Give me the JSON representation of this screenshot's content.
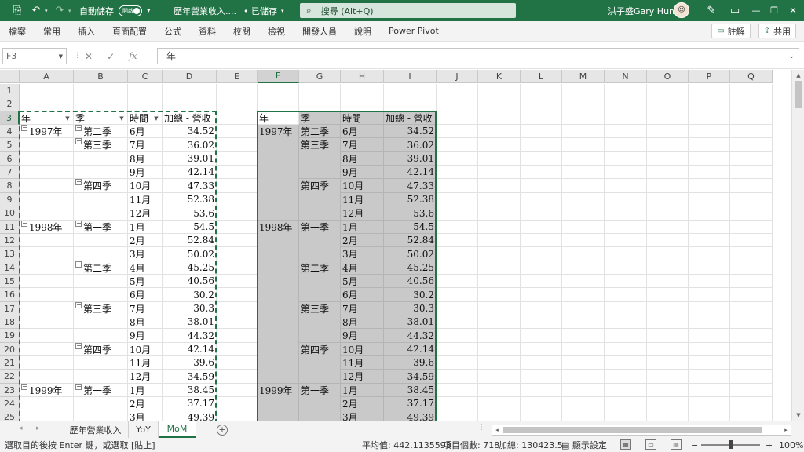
{
  "titlebar": {
    "autosave_label": "自動儲存",
    "autosave_state": "開啟",
    "doc_title": "歷年營業收入....",
    "saved_state": "• 已儲存",
    "search_placeholder": "搜尋 (Alt+Q)",
    "user_name": "洪子盛Gary Hung"
  },
  "ribbon": {
    "tabs": [
      "檔案",
      "常用",
      "插入",
      "頁面配置",
      "公式",
      "資料",
      "校閱",
      "檢視",
      "開發人員",
      "說明",
      "Power Pivot"
    ],
    "comment_label": "註解",
    "share_label": "共用"
  },
  "formula_bar": {
    "name_box": "F3",
    "fx": "fx",
    "value": "年"
  },
  "columns": [
    "A",
    "B",
    "C",
    "D",
    "E",
    "F",
    "G",
    "H",
    "I",
    "J",
    "K",
    "L",
    "M",
    "N",
    "O",
    "P",
    "Q"
  ],
  "rows": [
    "1",
    "2",
    "3",
    "4",
    "5",
    "6",
    "7",
    "8",
    "9",
    "10",
    "11",
    "12",
    "13",
    "14",
    "15",
    "16",
    "17",
    "18",
    "19",
    "20",
    "21",
    "22",
    "23",
    "24",
    "25"
  ],
  "pivot": {
    "headers": [
      "年",
      "季",
      "時間",
      "加總 - 營收"
    ],
    "rows": [
      {
        "year": "1997年",
        "quarter": "第二季",
        "month": "6月",
        "value": "34.52"
      },
      {
        "year": "",
        "quarter": "第三季",
        "month": "7月",
        "value": "36.02"
      },
      {
        "year": "",
        "quarter": "",
        "month": "8月",
        "value": "39.01"
      },
      {
        "year": "",
        "quarter": "",
        "month": "9月",
        "value": "42.14"
      },
      {
        "year": "",
        "quarter": "第四季",
        "month": "10月",
        "value": "47.33"
      },
      {
        "year": "",
        "quarter": "",
        "month": "11月",
        "value": "52.38"
      },
      {
        "year": "",
        "quarter": "",
        "month": "12月",
        "value": "53.6"
      },
      {
        "year": "1998年",
        "quarter": "第一季",
        "month": "1月",
        "value": "54.5"
      },
      {
        "year": "",
        "quarter": "",
        "month": "2月",
        "value": "52.84"
      },
      {
        "year": "",
        "quarter": "",
        "month": "3月",
        "value": "50.02"
      },
      {
        "year": "",
        "quarter": "第二季",
        "month": "4月",
        "value": "45.25"
      },
      {
        "year": "",
        "quarter": "",
        "month": "5月",
        "value": "40.56"
      },
      {
        "year": "",
        "quarter": "",
        "month": "6月",
        "value": "30.2"
      },
      {
        "year": "",
        "quarter": "第三季",
        "month": "7月",
        "value": "30.3"
      },
      {
        "year": "",
        "quarter": "",
        "month": "8月",
        "value": "38.01"
      },
      {
        "year": "",
        "quarter": "",
        "month": "9月",
        "value": "44.32"
      },
      {
        "year": "",
        "quarter": "第四季",
        "month": "10月",
        "value": "42.14"
      },
      {
        "year": "",
        "quarter": "",
        "month": "11月",
        "value": "39.6"
      },
      {
        "year": "",
        "quarter": "",
        "month": "12月",
        "value": "34.59"
      },
      {
        "year": "1999年",
        "quarter": "第一季",
        "month": "1月",
        "value": "38.45"
      },
      {
        "year": "",
        "quarter": "",
        "month": "2月",
        "value": "37.17"
      },
      {
        "year": "",
        "quarter": "",
        "month": "3月",
        "value": "49.39"
      }
    ]
  },
  "sheets": {
    "tabs": [
      "歷年營業收入",
      "YoY",
      "MoM"
    ],
    "active": "MoM"
  },
  "statusbar": {
    "message": "選取目的後按 Enter 鍵，或選取 [貼上]",
    "average": "平均值: 442.1135593",
    "count": "項目個數: 718",
    "sum": "加總: 130423.5",
    "display_settings": "顯示設定",
    "zoom": "100%"
  },
  "colors": {
    "excel_green": "#217346",
    "gray_fill": "#c9c9c9"
  }
}
